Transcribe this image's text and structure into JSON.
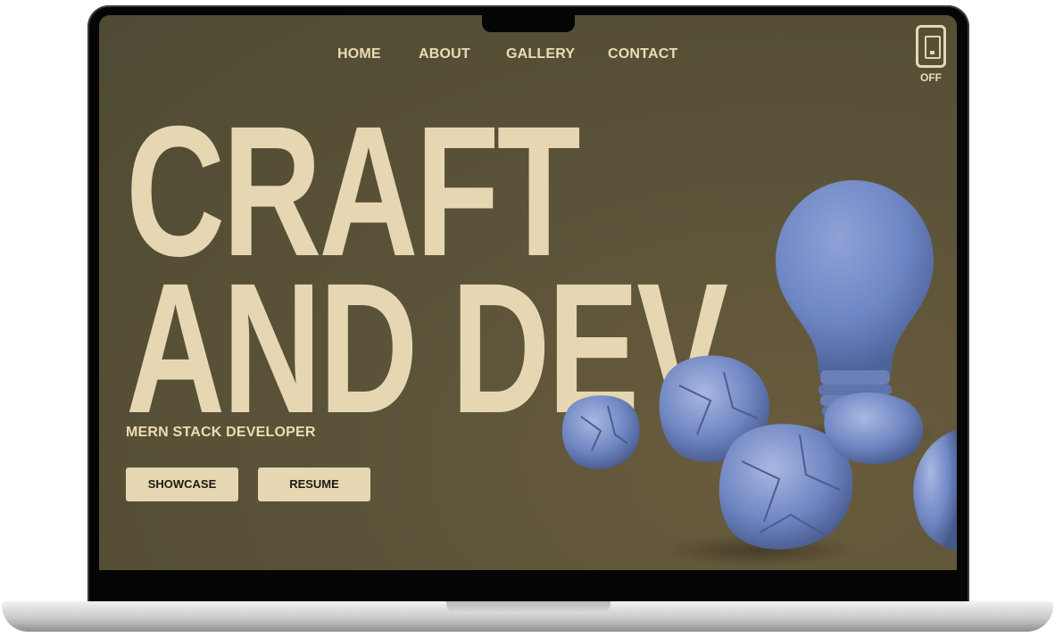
{
  "nav": {
    "items": [
      "HOME",
      "ABOUT",
      "GALLERY",
      "CONTACT"
    ]
  },
  "theme_toggle": {
    "icon": "phone-toggle-icon",
    "state_label": "OFF"
  },
  "hero": {
    "line1": "CRAFT",
    "line2": "AND DEV",
    "subtitle": "MERN STACK DEVELOPER"
  },
  "buttons": {
    "showcase": "SHOWCASE",
    "resume": "RESUME"
  },
  "colors": {
    "background": "#5b5339",
    "accent": "#e6d7b2",
    "bulb": "#6e86c4"
  }
}
